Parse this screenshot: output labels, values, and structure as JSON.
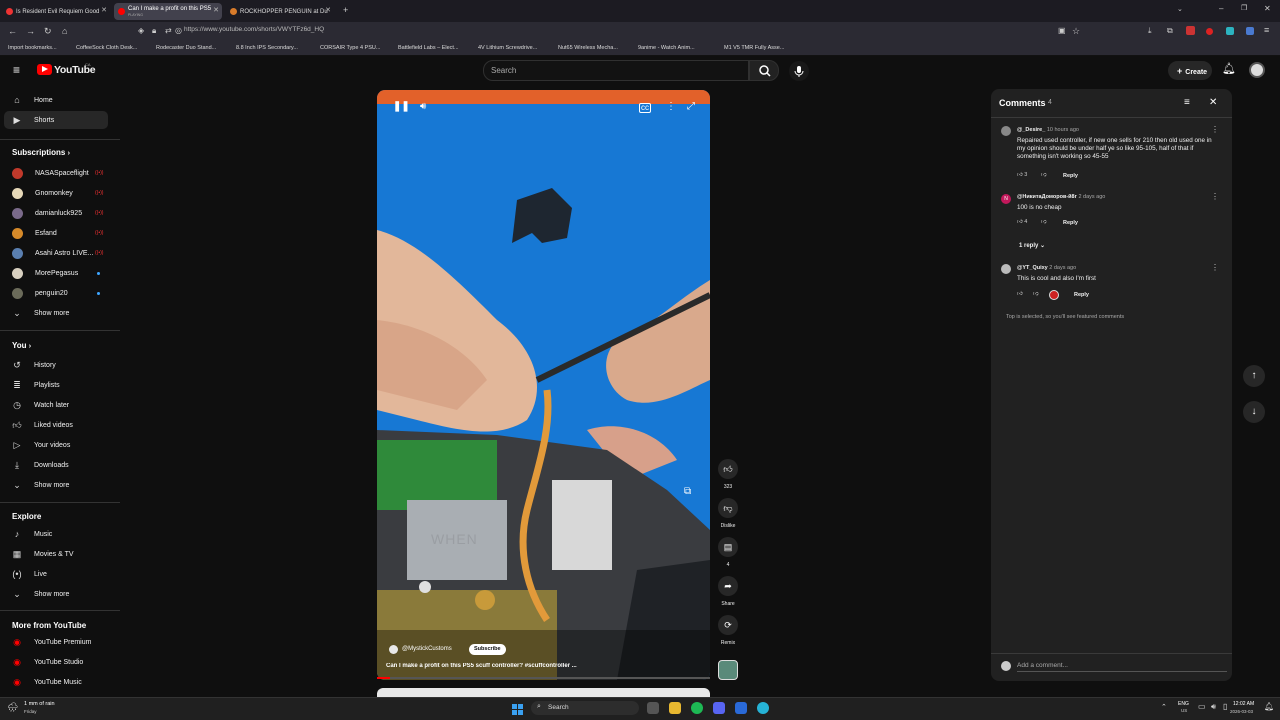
{
  "browser": {
    "tabs": [
      {
        "label": "Is Resident Evil Requiem Good",
        "active": false
      },
      {
        "label": "Can I make a profit on this PS5",
        "sub": "PLAYING",
        "active": true
      },
      {
        "label": "ROCKHOPPER PENGUIN at Du",
        "active": false
      }
    ],
    "url": "https://www.youtube.com/shorts/VWYTFz6d_HQ",
    "bookmarks": [
      "Import bookmarks...",
      "CoffeeSock Cloth Desk...",
      "Rodecaster Duo Stand...",
      "8.8 Inch IPS Secondary...",
      "CORSAIR Type 4 PSU...",
      "Battlefield Labs – Elect...",
      "4V Lithium Screwdrive...",
      "Nut65 Wireless Mecha...",
      "9anime - Watch Anim...",
      "M1 V5 TMR Fully Asse..."
    ]
  },
  "header": {
    "logo": "YouTube",
    "logo_country": "CA",
    "search_placeholder": "Search",
    "create_label": "Create"
  },
  "sidebar": {
    "main": [
      {
        "label": "Home",
        "icon": "home-icon"
      },
      {
        "label": "Shorts",
        "icon": "shorts-icon",
        "selected": true
      }
    ],
    "subscriptions_title": "Subscriptions",
    "subscriptions": [
      {
        "label": "NASASpaceflight",
        "color": "#c0392b",
        "live": true
      },
      {
        "label": "Gnomonkey",
        "color": "#e6d8b8",
        "live": true
      },
      {
        "label": "damianluck925",
        "color": "#7a6a8a",
        "live": true
      },
      {
        "label": "Esfand",
        "color": "#d68a2a",
        "live": true
      },
      {
        "label": "Asahi Astro LIVE...",
        "color": "#5a7fb0",
        "live": true
      },
      {
        "label": "MorePegasus",
        "color": "#d8d0c0",
        "new": true
      },
      {
        "label": "penguin20",
        "color": "#6b6b5a",
        "new": true
      }
    ],
    "show_more": "Show more",
    "you_title": "You",
    "you": [
      {
        "label": "History",
        "icon": "history-icon"
      },
      {
        "label": "Playlists",
        "icon": "playlists-icon"
      },
      {
        "label": "Watch later",
        "icon": "clock-icon"
      },
      {
        "label": "Liked videos",
        "icon": "thumbs-up-icon"
      },
      {
        "label": "Your videos",
        "icon": "video-icon"
      },
      {
        "label": "Downloads",
        "icon": "download-icon"
      }
    ],
    "explore_title": "Explore",
    "explore": [
      {
        "label": "Music",
        "icon": "music-icon"
      },
      {
        "label": "Movies & TV",
        "icon": "film-icon"
      },
      {
        "label": "Live",
        "icon": "live-icon"
      }
    ],
    "more_title": "More from YouTube",
    "more": [
      {
        "label": "YouTube Premium"
      },
      {
        "label": "YouTube Studio"
      },
      {
        "label": "YouTube Music"
      }
    ]
  },
  "video": {
    "overlay_text": "WHEN",
    "channel": "@MystickCustoms",
    "subscribe": "Subscribe",
    "title": "Can I make a profit on this PS5 scuff controller? ",
    "hashtag": "#scuffcontroller ...",
    "progress": 0.04
  },
  "actions": {
    "likes": "323",
    "dislike": "Dislike",
    "comments": "4",
    "share": "Share",
    "remix": "Remix"
  },
  "comments": {
    "title": "Comments",
    "count": "4",
    "items": [
      {
        "user": "@_Desire_",
        "time": "10 hours ago",
        "text": "Repaired used controller, if new one sells for 210 then old used one in my opinion should be under half ye so like 95-105, half of that if something isn't working so 45-55",
        "likes": "3",
        "reply": "Reply"
      },
      {
        "user": "@НикитаДоморов-й8г",
        "time": "2 days ago",
        "text": "100 is no cheap",
        "likes": "4",
        "reply": "Reply",
        "replies": "1 reply"
      },
      {
        "user": "@YT_Quixy",
        "time": "2 days ago",
        "text": "This is cool and also I'm first",
        "likes": "",
        "reply": "Reply"
      }
    ],
    "note": "Top is selected, so you'll see featured comments",
    "add_placeholder": "Add a comment..."
  },
  "taskbar": {
    "weather": "1 mm of rain",
    "weather_sub": "Friday",
    "search": "Search",
    "lang": "ENG",
    "lang_sub": "US",
    "time": "12:02 AM",
    "date": "2026-03-03"
  }
}
